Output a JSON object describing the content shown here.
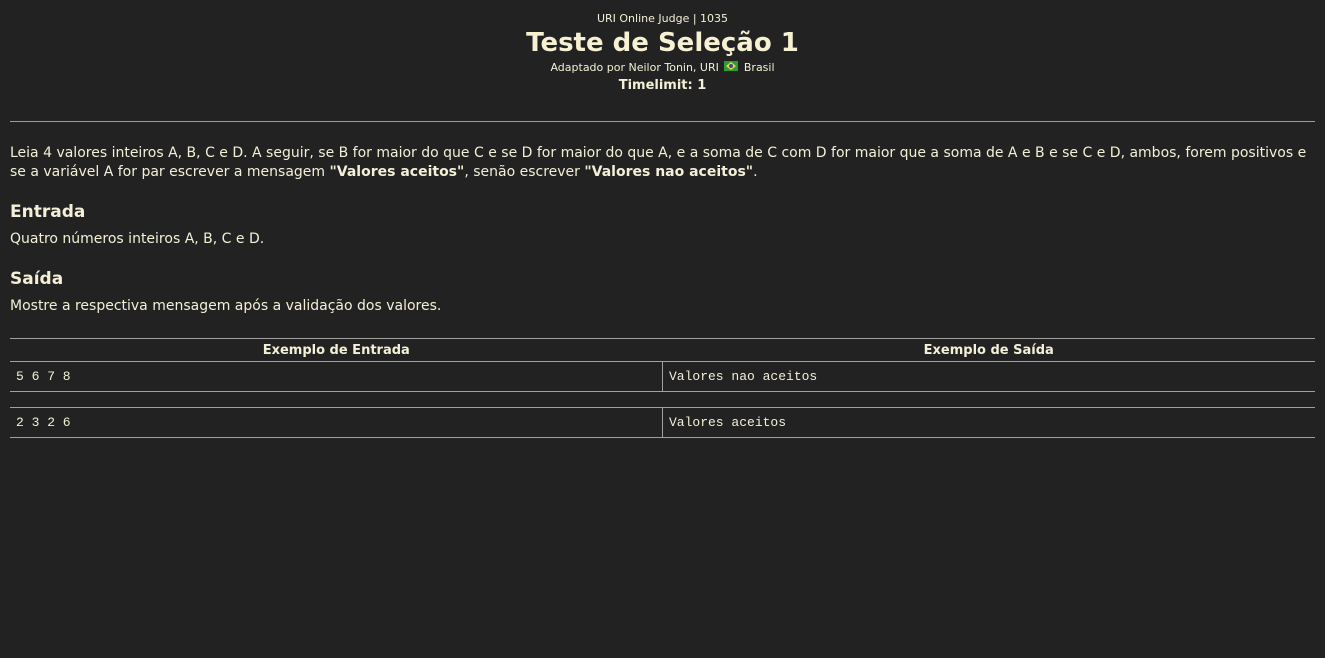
{
  "header": {
    "judge_line": "URI Online Judge | 1035",
    "title": "Teste de Seleção 1",
    "adapted_prefix": "Adaptado por Neilor Tonin, URI",
    "adapted_country": "Brasil",
    "timelimit": "Timelimit: 1"
  },
  "description": {
    "text_1": "Leia 4 valores inteiros A, B, C e D. A seguir, se B for maior do que C e se D for maior do que A, e a soma de C com D for maior que a soma de A e B e se C e D, ambos, forem positivos e se a variável A for par escrever a mensagem ",
    "bold_1": "\"Valores aceitos\"",
    "text_2": ", senão escrever ",
    "bold_2": "\"Valores nao aceitos\"",
    "text_3": "."
  },
  "input_section": {
    "title": "Entrada",
    "text": "Quatro números inteiros A, B, C e D."
  },
  "output_section": {
    "title": "Saída",
    "text": "Mostre a respectiva mensagem após a validação dos valores."
  },
  "samples": {
    "input_header": "Exemplo de Entrada",
    "output_header": "Exemplo de Saída",
    "rows": [
      {
        "input": "5 6 7 8",
        "output": "Valores nao aceitos"
      },
      {
        "input": "2 3 2 6",
        "output": "Valores aceitos"
      }
    ]
  },
  "icons": {
    "flag": "brazil-flag-icon"
  },
  "colors": {
    "background": "#222222",
    "text": "#f3f0d7",
    "rule": "#9c9c9c"
  }
}
